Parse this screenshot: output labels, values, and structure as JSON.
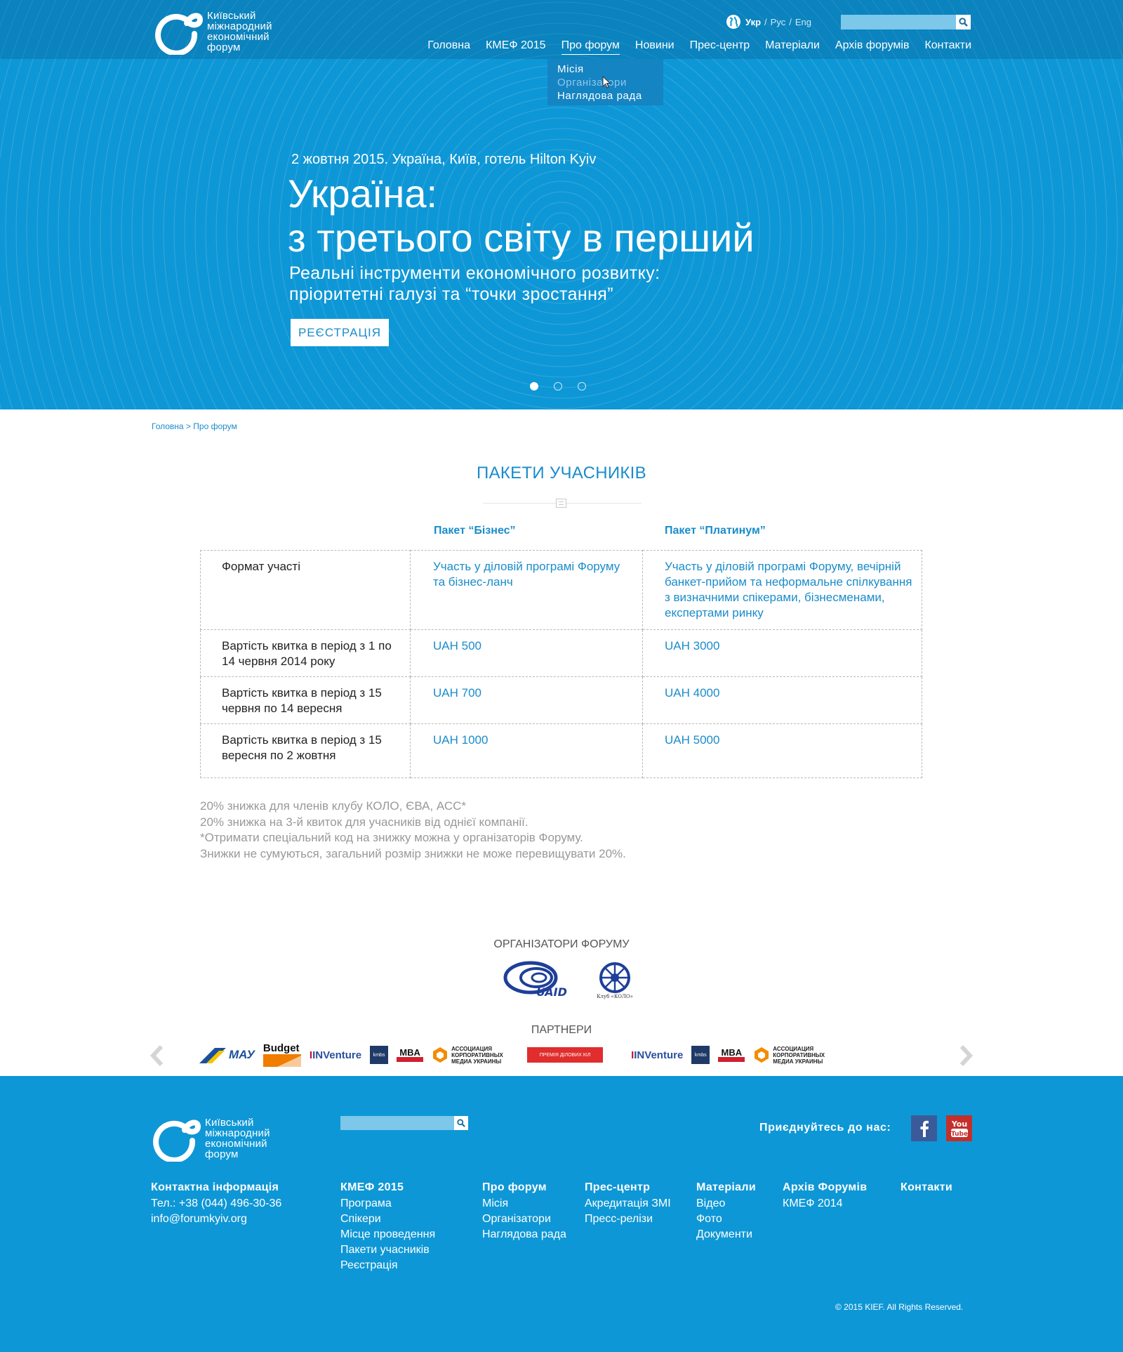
{
  "brand": {
    "logo_lines": [
      "Київський",
      "міжнародний",
      "економічний",
      "форум"
    ]
  },
  "lang": {
    "active": "Укр",
    "others": [
      "Рус",
      "Eng"
    ]
  },
  "search": {
    "placeholder": ""
  },
  "nav": {
    "items": [
      "Головна",
      "КМЕФ 2015",
      "Про форум",
      "Новини",
      "Прес-центр",
      "Матеріали",
      "Архів форумів",
      "Контакти"
    ],
    "current": "Про форум",
    "dropdown": [
      "Місія",
      "Організатори",
      "Наглядова рада"
    ],
    "dropdown_hover": "Організатори"
  },
  "hero": {
    "date": "2 жовтня 2015. Україна, Київ, готель Hilton Kyiv",
    "title_lines": [
      "Україна:",
      "з третього світу в перший"
    ],
    "subtitle_lines": [
      "Реальні інструменти економічного розвитку:",
      "пріоритетні галузі та “точки зростання”"
    ],
    "button": "РЕЄСТРАЦІЯ",
    "slides": 3,
    "active_slide": 1
  },
  "breadcrumb": "Головна > Про форум",
  "packages": {
    "title": "ПАКЕТИ УЧАСНИКІВ",
    "columns": [
      "Пакет “Бізнес”",
      "Пакет “Платинум”"
    ],
    "rows": [
      {
        "label": "Формат участі",
        "business": "Участь у діловій програмі Форуму та бізнес-ланч",
        "platinum": "Участь у діловій програмі Форуму, вечірній банкет-прийом та неформальне спілкування з визначними спікерами, бізнесменами,  експертами ринку"
      },
      {
        "label": "Вартість квитка в період з 1 по 14 червня 2014 року",
        "business": "UAH 500",
        "platinum": "UAH 3000"
      },
      {
        "label": "Вартість квитка в період з 15 червня по 14 вересня",
        "business": "UAH 700",
        "platinum": "UAH 4000"
      },
      {
        "label": "Вартість квитка в період з 15 вересня по 2 жовтня",
        "business": "UAH 1000",
        "platinum": "UAH 5000"
      }
    ],
    "notes": [
      "20% знижка для членів клубу КОЛО, ЄВА, АСС*",
      "20% знижка на 3-й квиток для учасників від однієї компанії.",
      "*Отримати спеціальний код на знижку можна у організаторів Форуму.",
      "Знижки не сумуються, загальний розмір знижки не може перевищувати 20%."
    ]
  },
  "organizers": {
    "title": "ОРГАНІЗАТОРИ ФОРУМУ",
    "logos": [
      {
        "icon": "uaid-logo",
        "text": "UAID"
      },
      {
        "icon": "kolo-club-logo",
        "text": "Клуб «КОЛО»"
      }
    ]
  },
  "partners": {
    "title": "ПАРТНЕРИ",
    "logos": [
      {
        "icon": "mau-logo",
        "text": "МАУ"
      },
      {
        "icon": "budget-logo",
        "text": "Budget"
      },
      {
        "icon": "inventure-logo",
        "text": "INVenture"
      },
      {
        "icon": "kmbs-logo",
        "text": "kmbs"
      },
      {
        "icon": "mba-strategy-logo",
        "text": "MBA"
      },
      {
        "icon": "akmu-logo",
        "text": "АССОЦИАЦИЯ КОРПОРАТИВНЫХ МЕДИА УКРАИНЫ"
      },
      {
        "icon": "press-award-logo",
        "text": "ПРЕМІЯ ДІЛОВИХ КІЛ"
      },
      {
        "icon": "inventure-logo",
        "text": "INVenture"
      },
      {
        "icon": "kmbs-logo",
        "text": "kmbs"
      },
      {
        "icon": "mba-strategy-logo",
        "text": "MBA"
      },
      {
        "icon": "akmu-logo",
        "text": "АССОЦИАЦИЯ КОРПОРАТИВНЫХ МЕДИА УКРАИНЫ"
      }
    ]
  },
  "footer": {
    "join": "Приєднуйтесь до нас:",
    "contact": {
      "title": "Контактна  інформація",
      "phone": "Тел.: +38 (044) 496-30-36",
      "email": "info@forumkyiv.org"
    },
    "columns": [
      {
        "title": "КМЕФ 2015",
        "links": [
          "Програма",
          "Спікери",
          "Місце проведення",
          "Пакети учасників",
          "Реєстрація"
        ]
      },
      {
        "title": "Про форум",
        "links": [
          "Місія",
          "Організатори",
          "Наглядова рада"
        ]
      },
      {
        "title": "Прес-центр",
        "links": [
          "Акредитація ЗМІ",
          "Пресс-релізи"
        ]
      },
      {
        "title": "Матеріали",
        "links": [
          "Відео",
          "Фото",
          "Документи"
        ]
      },
      {
        "title": "Архів Форумів",
        "links": [
          "КМЕФ 2014"
        ]
      },
      {
        "title": "Контакти",
        "links": []
      }
    ],
    "copyright": "© 2015 KIEF. All Rights Reserved."
  },
  "colors": {
    "brand_blue": "#0e97d6",
    "link_blue": "#1a8ccb",
    "note_gray": "#999999"
  }
}
